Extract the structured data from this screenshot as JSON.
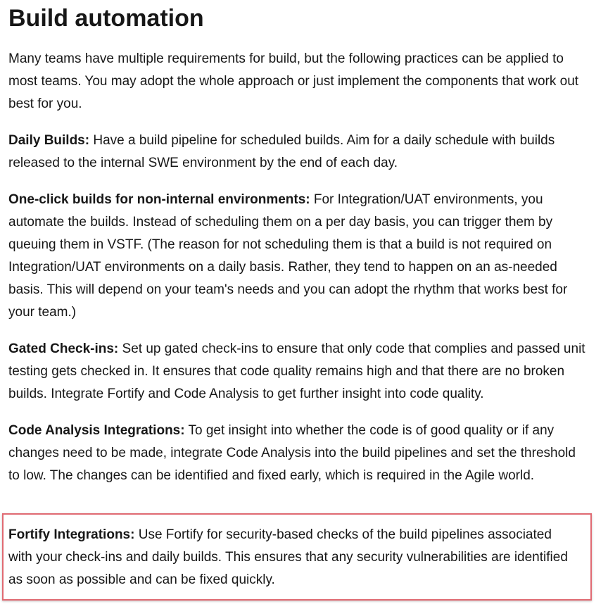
{
  "page_title": "Build automation",
  "intro": "Many teams have multiple requirements for build, but the following practices can be applied to most teams. You may adopt the whole approach or just implement the components that work out best for you.",
  "practices": [
    {
      "term": "Daily Builds:",
      "text": " Have a build pipeline for scheduled builds. Aim for a daily schedule with builds released to the internal SWE environment by the end of each day."
    },
    {
      "term": "One-click builds for non-internal environments:",
      "text": " For Integration/UAT environments, you automate the builds. Instead of scheduling them on a per day basis, you can trigger them by queuing them in VSTF. (The reason for not scheduling them is that a build is not required on Integration/UAT environments on a daily basis. Rather, they tend to happen on an as-needed basis. This will depend on your team's needs and you can adopt the rhythm that works best for your team.)"
    },
    {
      "term": "Gated Check-ins:",
      "text": " Set up gated check-ins to ensure that only code that complies and passed unit testing gets checked in. It ensures that code quality remains high and that there are no broken builds. Integrate Fortify and Code Analysis to get further insight into code quality."
    },
    {
      "term": "Code Analysis Integrations:",
      "text": " To get insight into whether the code is of good quality or if any changes need to be made, integrate Code Analysis into the build pipelines and set the threshold to low. The changes can be identified and fixed early, which is required in the Agile world."
    },
    {
      "term": "Fortify Integrations:",
      "text": " Use Fortify for security-based checks of the build pipelines associated with your check-ins and daily builds. This ensures that any security vulnerabilities are identified as soon as possible and can be fixed quickly."
    }
  ],
  "colors": {
    "text": "#171717",
    "highlight_border": "#e06a72",
    "background": "#ffffff"
  }
}
